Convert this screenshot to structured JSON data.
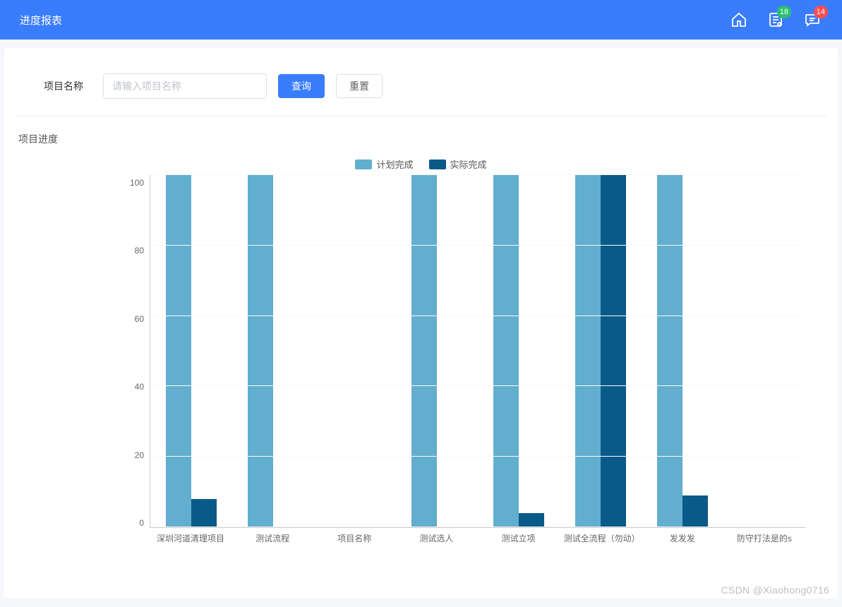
{
  "header": {
    "title": "进度报表",
    "badges": {
      "list": "18",
      "msg": "14"
    }
  },
  "search": {
    "label": "项目名称",
    "placeholder": "请输入项目名称",
    "query_btn": "查询",
    "reset_btn": "重置"
  },
  "section": {
    "title": "项目进度"
  },
  "legend": {
    "plan": "计划完成",
    "actual": "实际完成"
  },
  "colors": {
    "accent": "#3a7dfc",
    "bar_plan": "#61aecf",
    "bar_actual": "#0a5a89"
  },
  "chart_data": {
    "type": "bar",
    "ylabel": "",
    "xlabel": "",
    "ylim": [
      0,
      100
    ],
    "y_ticks": [
      0,
      20,
      40,
      60,
      80,
      100
    ],
    "categories": [
      "深圳河道清理项目",
      "测试流程",
      "项目名称",
      "测试选人",
      "测试立项",
      "测试全流程（勿动）",
      "发发发",
      "防守打法是的s"
    ],
    "series": [
      {
        "name": "计划完成",
        "values": [
          100,
          100,
          0,
          100,
          100,
          100,
          100,
          0
        ]
      },
      {
        "name": "实际完成",
        "values": [
          8,
          0,
          0,
          0,
          4,
          100,
          9,
          0
        ]
      }
    ]
  },
  "watermark": "CSDN @Xiaohong0716"
}
